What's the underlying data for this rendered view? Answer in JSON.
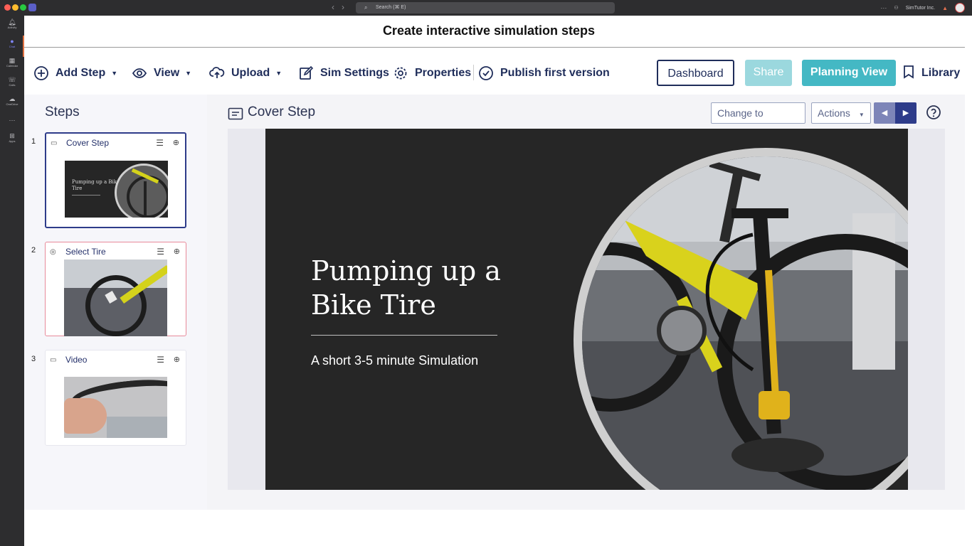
{
  "window": {
    "search_placeholder": "Search (⌘ E)",
    "org_name": "SimTutor Inc.",
    "rail": [
      {
        "label": "Activity",
        "icon": "bell-icon"
      },
      {
        "label": "Chat",
        "icon": "chat-icon"
      },
      {
        "label": "Calendar",
        "icon": "calendar-icon"
      },
      {
        "label": "Calls",
        "icon": "phone-icon"
      },
      {
        "label": "OneDrive",
        "icon": "cloud-icon"
      },
      {
        "label": "",
        "icon": "more-icon"
      },
      {
        "label": "Apps",
        "icon": "apps-icon"
      }
    ]
  },
  "page": {
    "title": "Create interactive simulation steps"
  },
  "toolbar": {
    "add_step": "Add Step",
    "view": "View",
    "upload": "Upload",
    "sim_settings": "Sim Settings",
    "properties": "Properties",
    "publish": "Publish first version",
    "dashboard": "Dashboard",
    "share": "Share",
    "planning_view": "Planning View",
    "library": "Library"
  },
  "steps": {
    "heading": "Steps",
    "items": [
      {
        "number": "1",
        "label": "Cover Step",
        "icon": "slide-icon",
        "thumb_title": "Pumping up a Bike Tire"
      },
      {
        "number": "2",
        "label": "Select Tire",
        "icon": "target-icon"
      },
      {
        "number": "3",
        "label": "Video",
        "icon": "video-icon"
      }
    ]
  },
  "canvas": {
    "heading": "Cover Step",
    "change_button": "Change to Planni...",
    "actions_button": "Actions",
    "slide": {
      "title": "Pumping up a Bike Tire",
      "subtitle": "A short 3-5 minute Simulation"
    }
  },
  "colors": {
    "navy": "#1f2d5a",
    "teal": "#44b8c4",
    "teal_light": "#9bd8de",
    "slide_bg": "#262626",
    "selected_pink": "#e88a9a"
  }
}
